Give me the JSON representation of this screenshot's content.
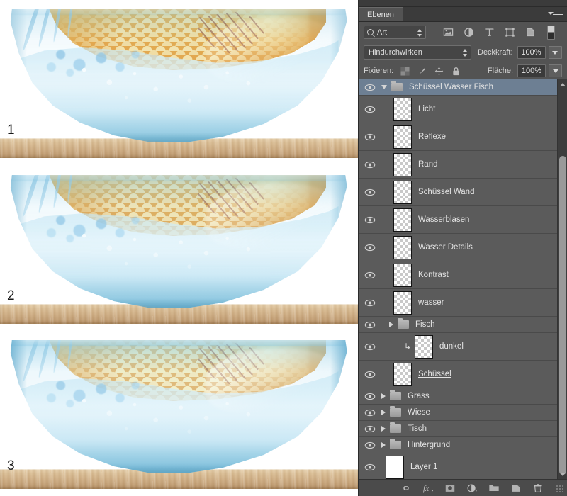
{
  "canvas": {
    "stages": [
      {
        "number": "1",
        "caption": ""
      },
      {
        "number": "2",
        "caption": ""
      },
      {
        "number": "3",
        "caption": ""
      }
    ]
  },
  "panel": {
    "tab_label": "Ebenen",
    "menu_icon": "panel-menu-icon",
    "filter": {
      "kind_label": "Art",
      "search_icon": "search-icon",
      "icons": [
        "pixel-layer-filter-icon",
        "adjustment-layer-filter-icon",
        "type-layer-filter-icon",
        "shape-layer-filter-icon",
        "smart-object-filter-icon"
      ],
      "toggle_icon": "filter-toggle-switch"
    },
    "blend": {
      "mode": "Hindurchwirken",
      "opacity_label": "Deckkraft:",
      "opacity_value": "100%"
    },
    "lock": {
      "label": "Fixieren:",
      "icons": [
        "lock-transparency-icon",
        "lock-image-icon",
        "lock-position-icon",
        "lock-all-icon"
      ],
      "fill_label": "Fläche:",
      "fill_value": "100%"
    },
    "layers": [
      {
        "name": "Schüssel Wasser Fisch",
        "type": "group",
        "expanded": true,
        "selected": true,
        "visible": true,
        "indent": 0,
        "clipped": false,
        "renaming": false
      },
      {
        "name": "Licht",
        "type": "layer",
        "visible": true,
        "indent": 1,
        "clipped": false,
        "renaming": false,
        "thumb": "transparent"
      },
      {
        "name": "Reflexe",
        "type": "layer",
        "visible": true,
        "indent": 1,
        "clipped": false,
        "renaming": false,
        "thumb": "transparent"
      },
      {
        "name": "Rand",
        "type": "layer",
        "visible": true,
        "indent": 1,
        "clipped": false,
        "renaming": false,
        "thumb": "transparent"
      },
      {
        "name": "Schüssel Wand",
        "type": "layer",
        "visible": true,
        "indent": 1,
        "clipped": false,
        "renaming": false,
        "thumb": "transparent"
      },
      {
        "name": "Wasserblasen",
        "type": "layer",
        "visible": true,
        "indent": 1,
        "clipped": false,
        "renaming": false,
        "thumb": "transparent"
      },
      {
        "name": "Wasser Details",
        "type": "layer",
        "visible": true,
        "indent": 1,
        "clipped": false,
        "renaming": false,
        "thumb": "transparent"
      },
      {
        "name": "Kontrast",
        "type": "layer",
        "visible": true,
        "indent": 1,
        "clipped": false,
        "renaming": false,
        "thumb": "transparent"
      },
      {
        "name": "wasser",
        "type": "layer",
        "visible": true,
        "indent": 1,
        "clipped": false,
        "renaming": false,
        "thumb": "transparent"
      },
      {
        "name": "Fisch",
        "type": "group",
        "expanded": false,
        "visible": true,
        "indent": 1,
        "clipped": false,
        "renaming": false
      },
      {
        "name": "dunkel",
        "type": "layer",
        "visible": true,
        "indent": 2,
        "clipped": true,
        "renaming": false,
        "thumb": "transparent"
      },
      {
        "name": "Schüssel",
        "type": "layer",
        "visible": true,
        "indent": 1,
        "clipped": false,
        "renaming": true,
        "thumb": "transparent"
      },
      {
        "name": "Grass",
        "type": "group",
        "expanded": false,
        "visible": true,
        "indent": 0,
        "clipped": false,
        "renaming": false
      },
      {
        "name": "Wiese",
        "type": "group",
        "expanded": false,
        "visible": true,
        "indent": 0,
        "clipped": false,
        "renaming": false
      },
      {
        "name": "Tisch",
        "type": "group",
        "expanded": false,
        "visible": true,
        "indent": 0,
        "clipped": false,
        "renaming": false
      },
      {
        "name": "Hintergrund",
        "type": "group",
        "expanded": false,
        "visible": true,
        "indent": 0,
        "clipped": false,
        "renaming": false
      },
      {
        "name": "Layer 1",
        "type": "layer",
        "visible": true,
        "indent": 0,
        "clipped": false,
        "renaming": false,
        "thumb": "solid-white"
      }
    ],
    "bottom_toolbar": [
      "link-layers-icon",
      "layer-style-fx-icon",
      "layer-mask-icon",
      "adjustment-layer-icon",
      "new-group-icon",
      "new-layer-icon",
      "delete-layer-icon"
    ],
    "scrollbar": {
      "up_icon": "scroll-up-arrow",
      "down_icon": "scroll-down-arrow"
    }
  },
  "colors": {
    "panel_bg": "#535353",
    "list_bg": "#5b5b5b",
    "selected_row": "#6d7f93",
    "text": "#e3e3e3",
    "bowl_blue": "#7ac0de",
    "fish_orange": "#e8a030",
    "wood": "#cfae84"
  }
}
